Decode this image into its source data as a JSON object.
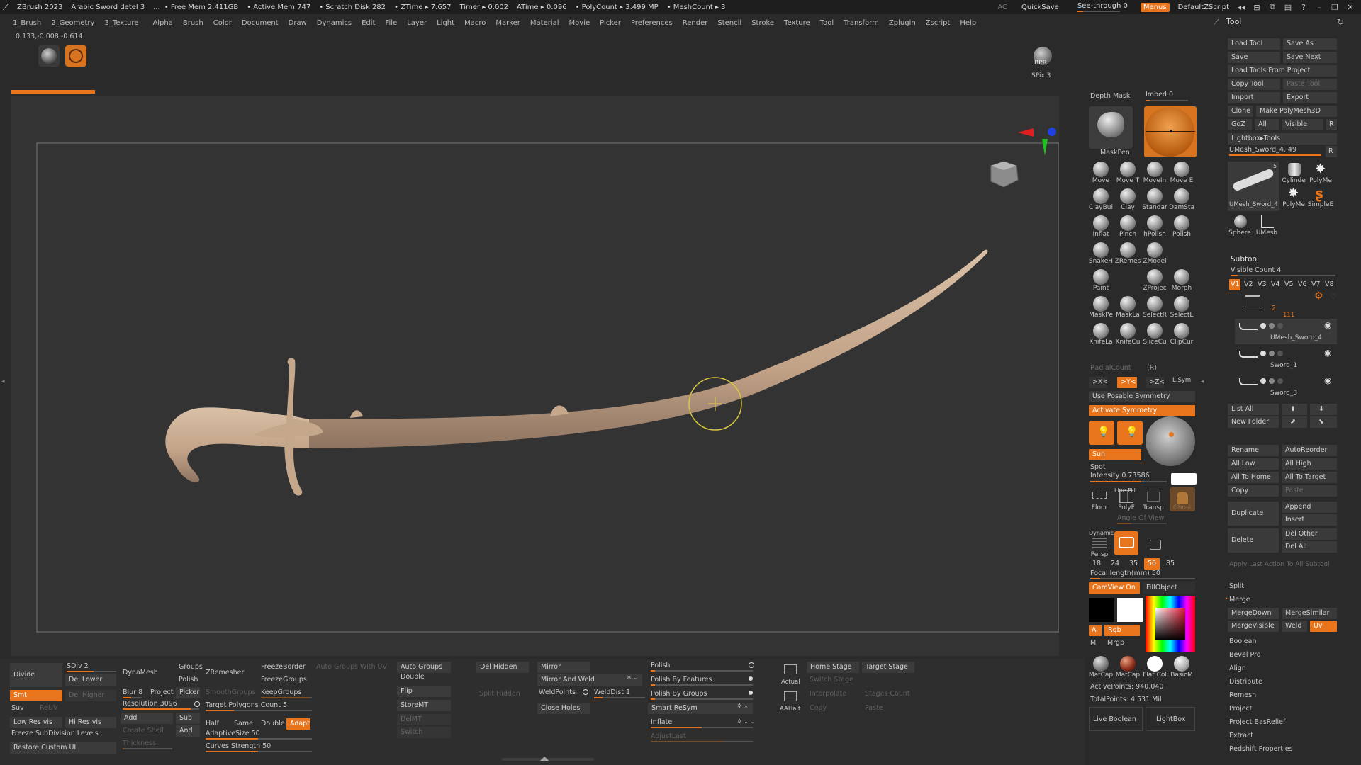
{
  "titlebar": {
    "app": "ZBrush 2023",
    "doc": "Arabic Sword detel 3",
    "dots": "...",
    "free_mem": "• Free Mem 2.411GB",
    "active_mem": "• Active Mem 747",
    "scratch": "• Scratch Disk 282",
    "ztime": "• ZTime ▸ 7.657",
    "timer": "Timer ▸ 0.002",
    "atime": "ATime ▸ 0.096",
    "polycount": "• PolyCount ▸ 3.499 MP",
    "meshcount": "• MeshCount ▸ 3",
    "ac": "AC",
    "quicksave": "QuickSave",
    "see_through": "See-through  0",
    "menus": "Menus",
    "script": "DefaultZScript"
  },
  "menubar": [
    "1_Brush",
    "2_Geometry",
    "3_Texture",
    "Alpha",
    "Brush",
    "Color",
    "Document",
    "Draw",
    "Dynamics",
    "Edit",
    "File",
    "Layer",
    "Light",
    "Macro",
    "Marker",
    "Material",
    "Movie",
    "Picker",
    "Preferences",
    "Render",
    "Stencil",
    "Stroke",
    "Texture",
    "Tool",
    "Transform",
    "Zplugin",
    "Zscript",
    "Help"
  ],
  "coords": "0.133,-0.008,-0.614",
  "viewport": {
    "bpr": "BPR",
    "spix": "SPix 3"
  },
  "midpanel": {
    "depth_mask": "Depth Mask",
    "imbed": "Imbed 0",
    "maskpen": "MaskPen",
    "brushes": [
      [
        "Move",
        "Move T",
        "MoveIn",
        "Move E"
      ],
      [
        "ClayBui",
        "Clay",
        "Standar",
        "DamSta"
      ],
      [
        "Inflat",
        "Pinch",
        "hPolish",
        "Polish"
      ],
      [
        "SnakeH",
        "ZRemes",
        "ZModel",
        ""
      ],
      [
        "Paint",
        "",
        "ZProjec",
        "Morph"
      ],
      [
        "MaskPe",
        "MaskLa",
        "SelectR",
        "SelectL"
      ],
      [
        "KnifeLa",
        "KnifeCu",
        "SliceCu",
        "ClipCur"
      ]
    ],
    "radial_count": "RadialCount",
    "r": "(R)",
    "sym_x": ">X<",
    "sym_y": ">Y<",
    "sym_z": ">Z<",
    "lsym": "L.Sym",
    "use_posable": "Use Posable Symmetry",
    "activate_sym": "Activate Symmetry",
    "sun": "Sun",
    "spot": "Spot",
    "intensity": "Intensity 0.73586",
    "floor": "Floor",
    "polyf": "PolyF",
    "transp": "Transp",
    "ghost": "Ghost",
    "line_fill": "Line Fill",
    "angle_of_view": "Angle Of View",
    "dynamic": "Dynamic",
    "persp": "Persp",
    "focal_opts": [
      "18",
      "24",
      "35",
      "50",
      "85"
    ],
    "focal_length": "Focal length(mm) 50",
    "camview": "CamView On",
    "fillobject": "FillObject",
    "a": "A",
    "rgb": "Rgb",
    "m": "M",
    "mrgb": "Mrgb",
    "materials": [
      "MatCap",
      "MatCap",
      "Flat Col",
      "BasicM"
    ],
    "active_points": "ActivePoints: 940,040",
    "total_points": "TotalPoints: 4.531 Mil",
    "live_boolean": "Live Boolean",
    "lightbox": "LightBox"
  },
  "rightpanel": {
    "title": "Tool",
    "buttons": [
      [
        "Load Tool",
        "Save As"
      ],
      [
        "Save",
        "Save Next"
      ],
      [
        "Load Tools From Project",
        ""
      ],
      [
        "Copy Tool",
        "Paste Tool"
      ],
      [
        "Import",
        "Export"
      ],
      [
        "Clone",
        "Make PolyMesh3D"
      ],
      [
        "GoZ",
        "All",
        "Visible",
        "R"
      ]
    ],
    "lightbox_tools": "Lightbox▸Tools",
    "umesh_slider": "UMesh_Sword_4. 49",
    "r": "R",
    "tools": [
      "UMesh_Sword_4",
      "Cylinde",
      "PolyMe",
      "PolyMe",
      "SimpleE",
      "Sphere",
      "UMesh"
    ],
    "tool_count": "5",
    "subtool": "Subtool",
    "visible_count": "Visible Count 4",
    "vers": [
      "V1",
      "V2",
      "V3",
      "V4",
      "V5",
      "V6",
      "V7",
      "V8"
    ],
    "folder_num": "2",
    "folder_mark": "111",
    "subtools": [
      "UMesh_Sword_4",
      "Sword_1",
      "Sword_3"
    ],
    "list_all": "List All",
    "new_folder": "New Folder",
    "actions": [
      [
        "Rename",
        "AutoReorder"
      ],
      [
        "All Low",
        "All High"
      ],
      [
        "All To Home",
        "All To Target"
      ],
      [
        "Copy",
        "Paste"
      ]
    ],
    "duplicate": "Duplicate",
    "append": "Append",
    "insert": "Insert",
    "delete": "Delete",
    "del_other": "Del Other",
    "del_all": "Del All",
    "apply_last": "Apply Last Action To All Subtool",
    "split": "Split",
    "merge": "Merge",
    "merge_down": "MergeDown",
    "merge_similar": "MergeSimilar",
    "merge_visible": "MergeVisible",
    "weld": "Weld",
    "uv": "Uv",
    "menu_items": [
      "Boolean",
      "Bevel Pro",
      "Align",
      "Distribute",
      "Remesh",
      "Project",
      "Project BasRelief",
      "Extract",
      "Redshift Properties"
    ]
  },
  "bottom": {
    "divide": "Divide",
    "sdiv": "SDiv 2",
    "del_lower": "Del Lower",
    "smt": "Smt",
    "del_higher": "Del Higher",
    "suv": "Suv",
    "reuv": "ReUV",
    "low_res": "Low Res vis",
    "hi_res": "Hi Res vis",
    "freeze_sub": "Freeze SubDivision Levels",
    "restore_ui": "Restore Custom UI",
    "dynamesh": "DynaMesh",
    "groups": "Groups",
    "polish": "Polish",
    "blur": "Blur 8",
    "project": "Project",
    "picker": "Picker",
    "resolution": "Resolution 3096",
    "add": "Add",
    "sub": "Sub",
    "create_shell": "Create Shell",
    "and": "And",
    "thickness": "Thickness",
    "zremesher": "ZRemesher",
    "freeze_border": "FreezeBorder",
    "freeze_groups": "FreezeGroups",
    "smooth_groups": "SmoothGroups",
    "keep_groups": "KeepGroups",
    "target_poly": "Target Polygons Count 5",
    "half": "Half",
    "same": "Same",
    "double": "Double",
    "adapt": "Adapt",
    "adaptive_size": "AdaptiveSize 50",
    "curves_strength": "Curves Strength 50",
    "auto_groups_uv": "Auto Groups With UV",
    "auto_groups": "Auto Groups",
    "double2": "Double",
    "flip": "Flip",
    "storemt": "StoreMT",
    "delmt": "DelMT",
    "switch": "Switch",
    "del_hidden": "Del Hidden",
    "split_hidden": "Split Hidden",
    "mirror": "Mirror",
    "mirror_weld": "Mirror And Weld",
    "weld_points": "WeldPoints",
    "weld_dist": "WeldDist 1",
    "close_holes": "Close Holes",
    "polish2": "Polish",
    "polish_features": "Polish By Features",
    "polish_groups": "Polish By Groups",
    "smart_resym": "Smart ReSym",
    "inflate": "Inflate",
    "adjust_last": "AdjustLast",
    "actual": "Actual",
    "aahalf": "AAHalf",
    "home_stage": "Home Stage",
    "target_stage": "Target Stage",
    "switch_stage": "Switch Stage",
    "interpolate": "Interpolate",
    "stages_count": "Stages Count",
    "copy": "Copy",
    "paste": "Paste"
  },
  "colors": {
    "accent": "#e8741c",
    "background": "#2a2a2a",
    "viewport": "#333333",
    "sword": "#c9ad93"
  }
}
